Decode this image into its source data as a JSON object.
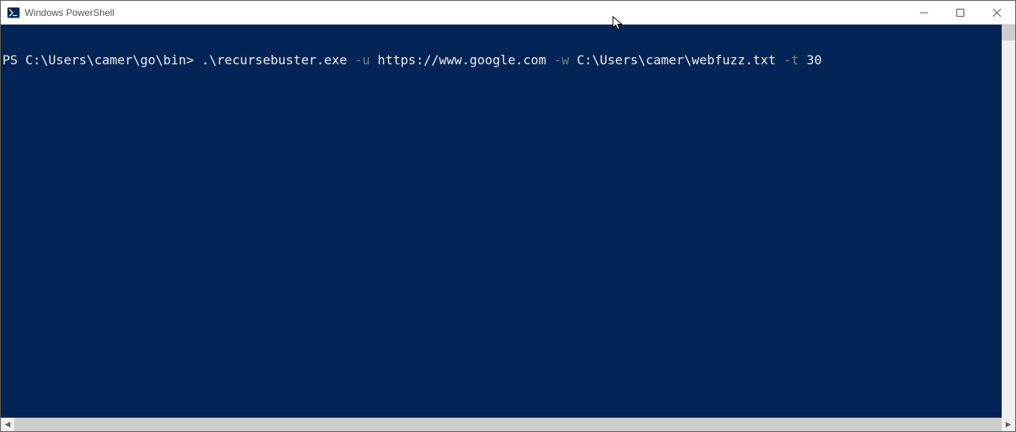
{
  "window": {
    "title": "Windows PowerShell"
  },
  "terminal": {
    "prompt": "PS C:\\Users\\camer\\go\\bin>",
    "cmd_exe": " .\\recursebuster.exe",
    "flag_u": " -u",
    "arg_url": " https://www.google.com",
    "flag_w": " -w",
    "arg_wordlist": " C:\\Users\\camer\\webfuzz.txt",
    "flag_t": " -t",
    "arg_threads": " 30"
  },
  "scrollbar": {
    "left_arrow": "◀",
    "right_arrow": "▶"
  }
}
